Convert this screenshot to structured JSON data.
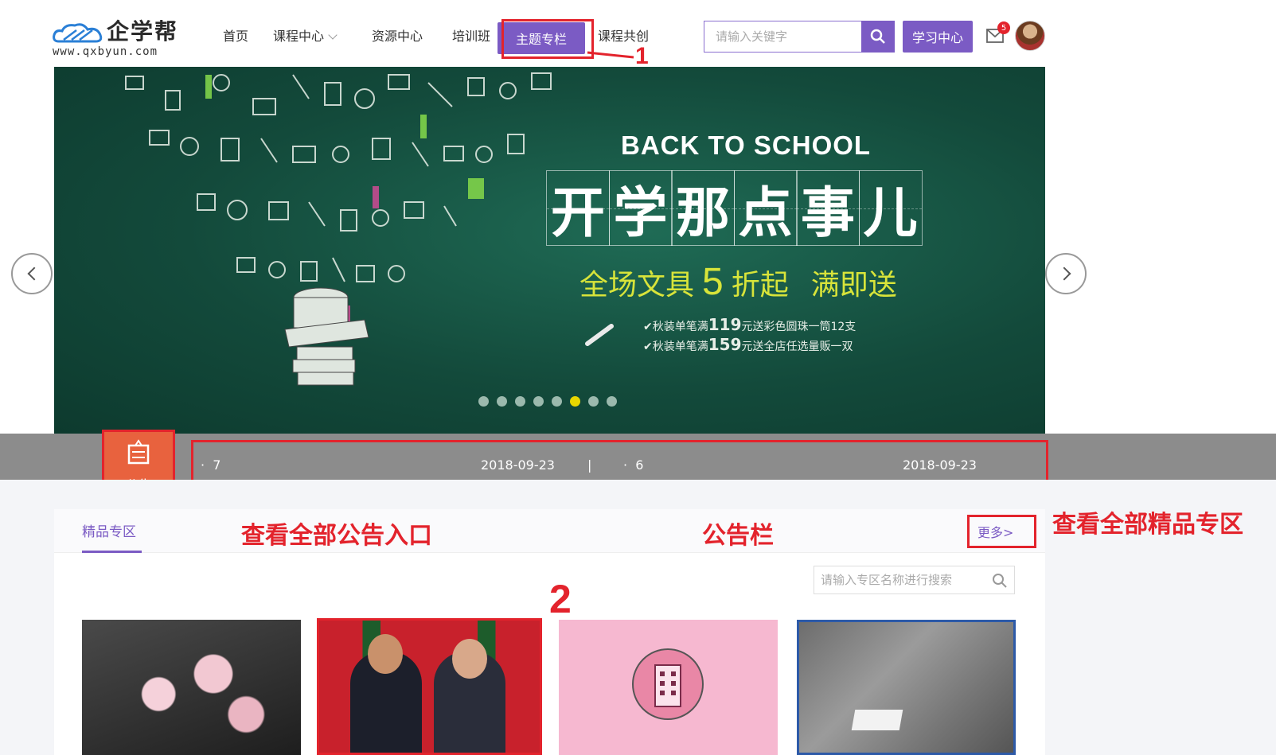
{
  "header": {
    "logo_text": "企学帮",
    "logo_url": "www.qxbyun.com",
    "nav": [
      {
        "label": "首页"
      },
      {
        "label": "课程中心",
        "has_dropdown": true
      },
      {
        "label": "资源中心"
      },
      {
        "label": "培训班"
      },
      {
        "label": "主题专栏",
        "active": true
      },
      {
        "label": "课程共创"
      }
    ],
    "search_placeholder": "请输入关键字",
    "study_center_label": "学习中心",
    "mail_badge": "5"
  },
  "banner": {
    "subtitle_en": "BACK TO SCHOOL",
    "title_chars": [
      "开",
      "学",
      "那",
      "点",
      "事",
      "儿"
    ],
    "promo_prefix": "全场文具",
    "promo_number": "5",
    "promo_suffix": "折起",
    "promo_extra": "满即送",
    "line1_prefix": "✔秋装单笔满",
    "line1_amount": "119",
    "line1_suffix": "元送彩色圆珠一筒12支",
    "line2_prefix": "✔秋装单笔满",
    "line2_amount": "159",
    "line2_suffix": "元送全店任选量贩一双",
    "slide_count": 8,
    "active_slide": 6
  },
  "notice": {
    "icon_label": "公告",
    "items": [
      {
        "bullet": "·",
        "title": "7",
        "date": "2018-09-23"
      },
      {
        "bullet": "·",
        "title": "6",
        "date": "2018-09-23"
      }
    ],
    "separator": "|"
  },
  "section": {
    "tab_label": "精品专区",
    "more_label": "更多>",
    "search_placeholder": "请输入专区名称进行搜索"
  },
  "annotations": {
    "num1": "1",
    "num2": "2",
    "label_notice_entry": "查看全部公告入口",
    "label_notice_bar": "公告栏",
    "label_all_zones": "查看全部精品专区"
  },
  "colors": {
    "accent": "#7b5bc4",
    "annotation": "#e3232c",
    "notice_bar": "#8c8c8c",
    "notice_icon": "#e8623e",
    "banner": "#134a3b",
    "promo": "#d8e43a"
  }
}
